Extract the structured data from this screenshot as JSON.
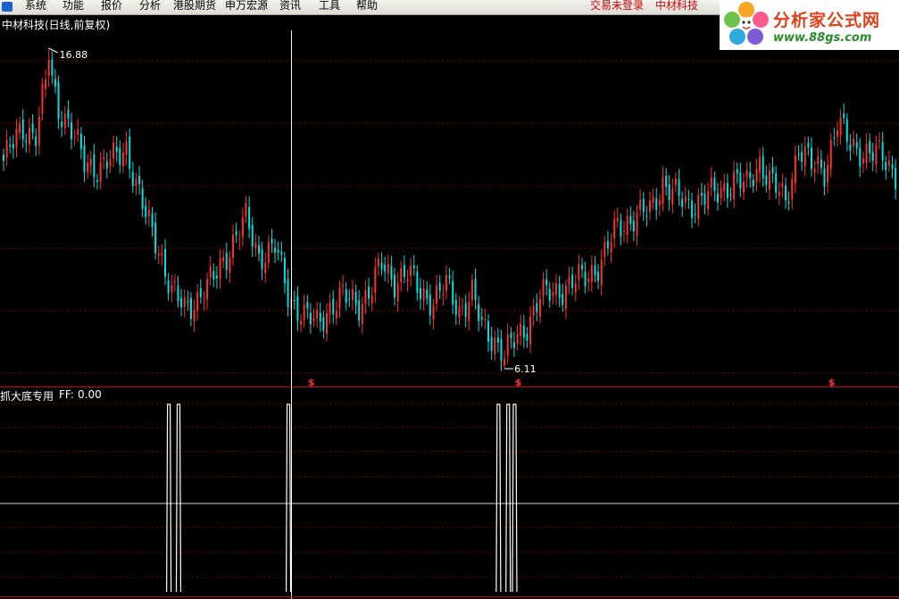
{
  "menu": {
    "items": [
      "系统",
      "功能",
      "报价",
      "分析",
      "港股期货",
      "申万宏源",
      "资讯",
      "工具",
      "帮助"
    ]
  },
  "status": {
    "trade_status": "交易未登录",
    "stock_link": "中材科技"
  },
  "logo": {
    "title": "分析家公式网",
    "url": "www.88gs.com"
  },
  "main_panel": {
    "title": "中材科技(日线,前复权)",
    "max_label": "16.88",
    "min_label": "6.11",
    "signal_glyph": "$"
  },
  "indicator_panel": {
    "title": "抓大底专用",
    "ff_label": "FF:",
    "ff_value": "0.00"
  },
  "colors": {
    "up": "#ff3030",
    "down": "#00e0e0",
    "grid": "#7a0000",
    "cursor": "#ffffff"
  },
  "chart_data": [
    {
      "type": "candlestick",
      "series_name": "中材科技",
      "ylim": [
        5.6,
        17.6
      ],
      "grid": true,
      "anchor_closes": [
        [
          0,
          13.1
        ],
        [
          6,
          14.2
        ],
        [
          10,
          14.0
        ],
        [
          14,
          16.2
        ],
        [
          17,
          14.9
        ],
        [
          20,
          14.4
        ],
        [
          25,
          13.0
        ],
        [
          30,
          12.9
        ],
        [
          35,
          13.2
        ],
        [
          38,
          13.6
        ],
        [
          41,
          12.3
        ],
        [
          44,
          11.2
        ],
        [
          48,
          10.2
        ],
        [
          52,
          8.7
        ],
        [
          56,
          8.1
        ],
        [
          60,
          8.5
        ],
        [
          65,
          9.1
        ],
        [
          70,
          10.2
        ],
        [
          75,
          11.1
        ],
        [
          79,
          9.9
        ],
        [
          84,
          10.2
        ],
        [
          88,
          8.6
        ],
        [
          93,
          7.9
        ],
        [
          97,
          7.6
        ],
        [
          101,
          8.2
        ],
        [
          105,
          8.5
        ],
        [
          110,
          8.3
        ],
        [
          114,
          8.8
        ],
        [
          117,
          9.6
        ],
        [
          121,
          9.1
        ],
        [
          125,
          9.3
        ],
        [
          129,
          8.7
        ],
        [
          133,
          8.4
        ],
        [
          137,
          8.9
        ],
        [
          141,
          8.1
        ],
        [
          145,
          8.6
        ],
        [
          148,
          7.5
        ],
        [
          152,
          7.1
        ],
        [
          155,
          6.6
        ],
        [
          158,
          7.0
        ],
        [
          162,
          7.6
        ],
        [
          166,
          8.5
        ],
        [
          170,
          8.7
        ],
        [
          175,
          8.9
        ],
        [
          180,
          9.2
        ],
        [
          185,
          9.7
        ],
        [
          190,
          10.9
        ],
        [
          195,
          11.2
        ],
        [
          200,
          11.4
        ],
        [
          204,
          12.4
        ],
        [
          208,
          11.9
        ],
        [
          212,
          11.6
        ],
        [
          217,
          11.9
        ],
        [
          221,
          12.0
        ],
        [
          226,
          12.5
        ],
        [
          230,
          12.2
        ],
        [
          234,
          13.1
        ],
        [
          238,
          12.3
        ],
        [
          242,
          11.7
        ],
        [
          246,
          13.6
        ],
        [
          250,
          12.9
        ],
        [
          254,
          12.8
        ],
        [
          258,
          14.4
        ],
        [
          262,
          13.6
        ],
        [
          267,
          13.4
        ],
        [
          272,
          13.2
        ],
        [
          276,
          12.7
        ]
      ],
      "marks": {
        "max": 16.88,
        "min": 6.11,
        "signal_dates": [
          95,
          159,
          256
        ]
      }
    },
    {
      "type": "signal",
      "series_name": "抓大底专用",
      "ylim": [
        0,
        1
      ],
      "pulses": [
        51,
        54,
        88,
        153,
        156,
        158
      ]
    }
  ]
}
